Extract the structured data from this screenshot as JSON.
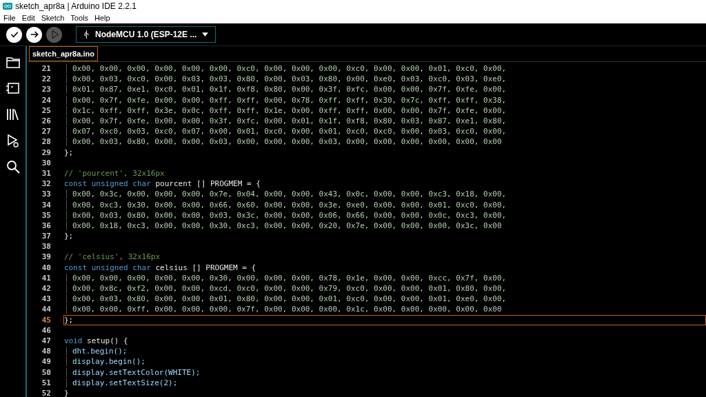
{
  "window": {
    "title": "sketch_apr8a | Arduino IDE 2.2.1"
  },
  "menu": [
    "File",
    "Edit",
    "Sketch",
    "Tools",
    "Help"
  ],
  "toolbar": {
    "buttons": [
      {
        "kind": "verify",
        "disabled": false
      },
      {
        "kind": "upload",
        "disabled": false
      },
      {
        "kind": "debug",
        "disabled": true
      }
    ],
    "board": "NodeMCU 1.0 (ESP-12E ..."
  },
  "sidebar": {
    "items": [
      {
        "kind": "folder",
        "selected": false
      },
      {
        "kind": "board",
        "selected": false
      },
      {
        "kind": "library",
        "selected": false
      },
      {
        "kind": "debug",
        "selected": false
      },
      {
        "kind": "search",
        "selected": false
      }
    ]
  },
  "tabs": [
    {
      "label": "sketch_apr8a.ino",
      "selected": true
    }
  ],
  "editor": {
    "lines": [
      {
        "number": "21",
        "indented": true,
        "current": false,
        "tokens": [
          {
            "kind": "literal",
            "text": "0x00, 0x00, 0x00, 0x00, 0x00, 0x00, 0xc0, 0x00, 0x00, 0x00, 0xc0, 0x00, 0x00, 0x01, 0xc0, 0x00,"
          }
        ]
      },
      {
        "number": "22",
        "indented": true,
        "current": false,
        "tokens": [
          {
            "kind": "literal",
            "text": "0x00, 0x03, 0xc0, 0x00, 0x03, 0x03, 0x80, 0x00, 0x03, 0x80, 0x00, 0xe0, 0x03, 0xc0, 0x03, 0xe0,"
          }
        ]
      },
      {
        "number": "23",
        "indented": true,
        "current": false,
        "tokens": [
          {
            "kind": "literal",
            "text": "0x01, 0x87, 0xe1, 0xc0, 0x01, 0x1f, 0xf8, 0x80, 0x00, 0x3f, 0xfc, 0x00, 0x00, 0x7f, 0xfe, 0x00,"
          }
        ]
      },
      {
        "number": "24",
        "indented": true,
        "current": false,
        "tokens": [
          {
            "kind": "literal",
            "text": "0x00, 0x7f, 0xfe, 0x00, 0x00, 0xff, 0xff, 0x00, 0x78, 0xff, 0xff, 0x30, 0x7c, 0xff, 0xff, 0x38,"
          }
        ]
      },
      {
        "number": "25",
        "indented": true,
        "current": false,
        "tokens": [
          {
            "kind": "literal",
            "text": "0x1c, 0xff, 0xff, 0x3e, 0x0c, 0xff, 0xff, 0x1e, 0x00, 0xff, 0xff, 0x00, 0x00, 0x7f, 0xfe, 0x00,"
          }
        ]
      },
      {
        "number": "26",
        "indented": true,
        "current": false,
        "tokens": [
          {
            "kind": "literal",
            "text": "0x00, 0x7f, 0xfe, 0x00, 0x00, 0x3f, 0xfc, 0x00, 0x01, 0x1f, 0xf8, 0x80, 0x03, 0x87, 0xe1, 0x80,"
          }
        ]
      },
      {
        "number": "27",
        "indented": true,
        "current": false,
        "tokens": [
          {
            "kind": "literal",
            "text": "0x07, 0xc0, 0x03, 0xc0, 0x07, 0x00, 0x01, 0xc0, 0x00, 0x01, 0xc0, 0xc0, 0x00, 0x03, 0xc0, 0x00,"
          }
        ]
      },
      {
        "number": "28",
        "indented": true,
        "current": false,
        "tokens": [
          {
            "kind": "literal",
            "text": "0x00, 0x03, 0x80, 0x00, 0x00, 0x03, 0x00, 0x00, 0x00, 0x03, 0x00, 0x00, 0x00, 0x00, 0x00, 0x00"
          }
        ]
      },
      {
        "number": "29",
        "indented": false,
        "current": false,
        "tokens": [
          {
            "kind": "plain",
            "text": "};"
          }
        ]
      },
      {
        "number": "30",
        "indented": false,
        "current": false
      },
      {
        "number": "31",
        "indented": false,
        "current": false,
        "tokens": [
          {
            "kind": "comment",
            "text": "// 'pourcent', 32x16px"
          }
        ]
      },
      {
        "number": "32",
        "indented": false,
        "current": false,
        "tokens": [
          {
            "kind": "keyword",
            "text": "const unsigned char"
          },
          {
            "kind": "plain",
            "text": " pourcent [] PROGMEM = {"
          }
        ]
      },
      {
        "number": "33",
        "indented": true,
        "current": false,
        "tokens": [
          {
            "kind": "literal",
            "text": "0x00, 0x3c, 0x00, 0x00, 0x00, 0x7e, 0x04, 0x00, 0x00, 0x43, 0x0c, 0x00, 0x00, 0xc3, 0x18, 0x00,"
          }
        ]
      },
      {
        "number": "34",
        "indented": true,
        "current": false,
        "tokens": [
          {
            "kind": "literal",
            "text": "0x00, 0xc3, 0x30, 0x00, 0x00, 0x66, 0x60, 0x00, 0x00, 0x3e, 0xe0, 0x00, 0x00, 0x01, 0xc0, 0x00,"
          }
        ]
      },
      {
        "number": "35",
        "indented": true,
        "current": false,
        "tokens": [
          {
            "kind": "literal",
            "text": "0x00, 0x03, 0x80, 0x00, 0x00, 0x03, 0x3c, 0x00, 0x00, 0x06, 0x66, 0x00, 0x00, 0x0c, 0xc3, 0x00,"
          }
        ]
      },
      {
        "number": "36",
        "indented": true,
        "current": false,
        "tokens": [
          {
            "kind": "literal",
            "text": "0x00, 0x18, 0xc3, 0x00, 0x00, 0x30, 0xc3, 0x00, 0x00, 0x20, 0x7e, 0x00, 0x00, 0x00, 0x3c, 0x00"
          }
        ]
      },
      {
        "number": "37",
        "indented": false,
        "current": false,
        "tokens": [
          {
            "kind": "plain",
            "text": "};"
          }
        ]
      },
      {
        "number": "38",
        "indented": false,
        "current": false
      },
      {
        "number": "39",
        "indented": false,
        "current": false,
        "tokens": [
          {
            "kind": "comment",
            "text": "// 'celsius', 32x16px"
          }
        ]
      },
      {
        "number": "40",
        "indented": false,
        "current": false,
        "tokens": [
          {
            "kind": "keyword",
            "text": "const unsigned char"
          },
          {
            "kind": "plain",
            "text": " celsius [] PROGMEM = {"
          }
        ]
      },
      {
        "number": "41",
        "indented": true,
        "current": false,
        "tokens": [
          {
            "kind": "literal",
            "text": "0x00, 0x00, 0x00, 0x00, 0x00, 0x30, 0x00, 0x00, 0x00, 0x78, 0x1e, 0x00, 0x00, 0xcc, 0x7f, 0x00,"
          }
        ]
      },
      {
        "number": "42",
        "indented": true,
        "current": false,
        "tokens": [
          {
            "kind": "literal",
            "text": "0x00, 0x8c, 0xf2, 0x00, 0x00, 0xcd, 0xc0, 0x00, 0x00, 0x79, 0xc0, 0x00, 0x00, 0x01, 0x80, 0x00,"
          }
        ]
      },
      {
        "number": "43",
        "indented": true,
        "current": false,
        "tokens": [
          {
            "kind": "literal",
            "text": "0x00, 0x03, 0x80, 0x00, 0x00, 0x01, 0x80, 0x00, 0x00, 0x01, 0xc0, 0x00, 0x00, 0x01, 0xe0, 0x00,"
          }
        ]
      },
      {
        "number": "44",
        "indented": true,
        "current": false,
        "tokens": [
          {
            "kind": "literal",
            "text": "0x00, 0x00, 0xff, 0x00, 0x00, 0x00, 0x7f, 0x00, 0x00, 0x00, 0x1c, 0x00, 0x00, 0x00, 0x00, 0x00"
          }
        ]
      },
      {
        "number": "45",
        "indented": false,
        "current": true,
        "tokens": [
          {
            "kind": "plain",
            "text": "};"
          }
        ]
      },
      {
        "number": "46",
        "indented": false,
        "current": false
      },
      {
        "number": "47",
        "indented": false,
        "current": false,
        "tokens": [
          {
            "kind": "keyword",
            "text": "void"
          },
          {
            "kind": "plain",
            "text": " setup() {"
          }
        ]
      },
      {
        "number": "48",
        "indented": true,
        "current": false,
        "tokens": [
          {
            "kind": "member",
            "text": "dht.begin();"
          }
        ]
      },
      {
        "number": "49",
        "indented": true,
        "current": false,
        "tokens": [
          {
            "kind": "member",
            "text": "display.begin();"
          }
        ]
      },
      {
        "number": "50",
        "indented": true,
        "current": false,
        "tokens": [
          {
            "kind": "member",
            "text": "display.setTextColor(WHITE);"
          }
        ]
      },
      {
        "number": "51",
        "indented": true,
        "current": false,
        "tokens": [
          {
            "kind": "member",
            "text": "display.setTextSize(2);"
          }
        ]
      },
      {
        "number": "52",
        "indented": false,
        "current": false,
        "tokens": [
          {
            "kind": "plain",
            "text": "}"
          }
        ]
      }
    ]
  }
}
